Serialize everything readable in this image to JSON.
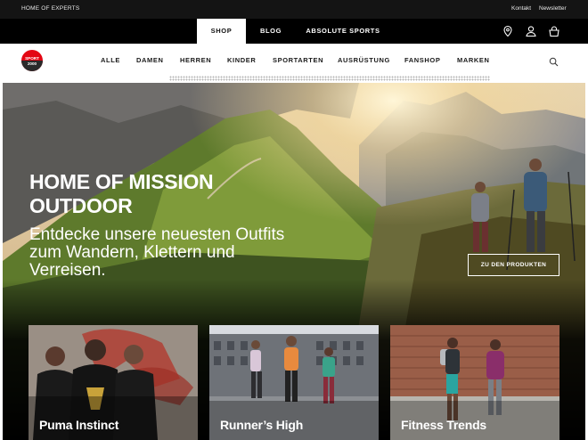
{
  "topbar": {
    "brand": "HOME OF EXPERTS",
    "links": [
      "Kontakt",
      "Newsletter"
    ]
  },
  "channels": [
    {
      "label": "SHOP",
      "active": true
    },
    {
      "label": "BLOG",
      "active": false
    },
    {
      "label": "ABSOLUTE SPORTS",
      "active": false
    }
  ],
  "header_icons": [
    "location-pin-icon",
    "user-icon",
    "cart-icon"
  ],
  "logo": {
    "line1": "SPORT",
    "line2": "2000"
  },
  "nav": [
    "ALLE",
    "DAMEN",
    "HERREN",
    "KINDER",
    "SPORTARTEN",
    "AUSRÜSTUNG",
    "FANSHOP",
    "MARKEN"
  ],
  "hero": {
    "title_line1": "HOME OF MISSION",
    "title_line2": "OUTDOOR",
    "subtitle": "Entdecke unsere neuesten Outfits zum Wandern, Klettern und Verreisen.",
    "cta": "ZU DEN PRODUKTEN"
  },
  "cards": [
    {
      "label": "Puma Instinct"
    },
    {
      "label": "Runner’s High"
    },
    {
      "label": "Fitness Trends"
    }
  ],
  "colors": {
    "topbar": "#141414",
    "channelbar": "#000000",
    "brand_red": "#e30613"
  }
}
